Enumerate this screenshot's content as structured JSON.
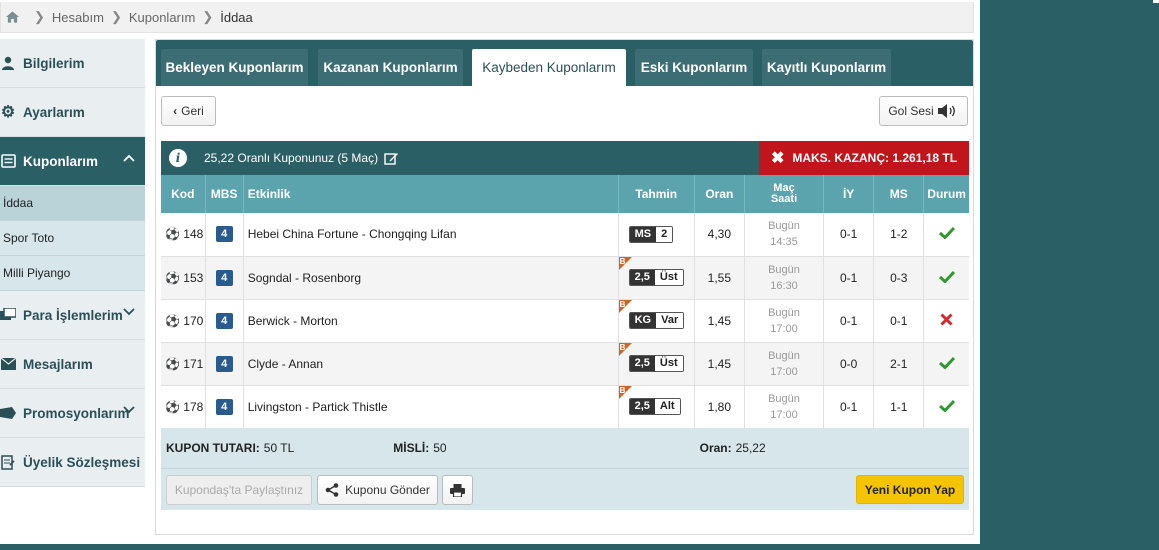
{
  "breadcrumb": {
    "items": [
      "Hesabım",
      "Kuponlarım"
    ],
    "current": "İddaa"
  },
  "sidebar": {
    "items": [
      {
        "label": "Bilgilerim",
        "icon": "user-icon"
      },
      {
        "label": "Ayarlarım",
        "icon": "gear-icon"
      },
      {
        "label": "Kuponlarım",
        "icon": "ticket-icon",
        "active": true
      },
      {
        "label": "Para İşlemlerim",
        "icon": "money-icon"
      },
      {
        "label": "Mesajlarım",
        "icon": "envelope-icon"
      },
      {
        "label": "Promosyonlarım",
        "icon": "tag-icon"
      },
      {
        "label": "Üyelik Sözleşmesi",
        "icon": "contract-icon"
      }
    ],
    "sub_items": [
      "İddaa",
      "Spor Toto",
      "Milli Piyango"
    ]
  },
  "tabs": [
    "Bekleyen Kuponlarım",
    "Kazanan Kuponlarım",
    "Kaybeden Kuponlarım",
    "Eski Kuponlarım",
    "Kayıtlı Kuponlarım"
  ],
  "active_tab": "Kaybeden Kuponlarım",
  "buttons": {
    "back": "Geri",
    "goal_sound": "Gol Sesi",
    "share": "Kupondaş'ta Paylaştınız",
    "send": "Kuponu Gönder",
    "new_coupon": "Yeni Kupon Yap"
  },
  "coupon": {
    "title": "25,22 Oranlı Kuponunuz (5 Maç)",
    "max_win": "MAKS. KAZANÇ: 1.261,18 TL",
    "columns": [
      "Kod",
      "MBS",
      "Etkinlik",
      "Tahmin",
      "Oran",
      "Maç Saati",
      "İY",
      "MS",
      "Durum"
    ],
    "rows": [
      {
        "kod": "148",
        "mbs": "4",
        "etkinlik": "Hebei China Fortune - Chongqing Lifan",
        "tahmin_k": "MS",
        "tahmin_v": "2",
        "badge": "",
        "oran": "4,30",
        "gun": "Bugün",
        "saat": "14:35",
        "iy": "0-1",
        "ms": "1-2",
        "durum": "won"
      },
      {
        "kod": "153",
        "mbs": "4",
        "etkinlik": "Sogndal - Rosenborg",
        "tahmin_k": "2,5",
        "tahmin_v": "Üst",
        "badge": "B",
        "oran": "1,55",
        "gun": "Bugün",
        "saat": "16:30",
        "iy": "0-1",
        "ms": "0-3",
        "durum": "won"
      },
      {
        "kod": "170",
        "mbs": "4",
        "etkinlik": "Berwick - Morton",
        "tahmin_k": "KG",
        "tahmin_v": "Var",
        "badge": "B",
        "oran": "1,45",
        "gun": "Bugün",
        "saat": "17:00",
        "iy": "0-1",
        "ms": "0-1",
        "durum": "lost"
      },
      {
        "kod": "171",
        "mbs": "4",
        "etkinlik": "Clyde - Annan",
        "tahmin_k": "2,5",
        "tahmin_v": "Üst",
        "badge": "B",
        "oran": "1,45",
        "gun": "Bugün",
        "saat": "17:00",
        "iy": "0-0",
        "ms": "2-1",
        "durum": "won"
      },
      {
        "kod": "178",
        "mbs": "4",
        "etkinlik": "Livingston - Partick Thistle",
        "tahmin_k": "2,5",
        "tahmin_v": "Alt",
        "badge": "B",
        "oran": "1,80",
        "gun": "Bugün",
        "saat": "17:00",
        "iy": "0-1",
        "ms": "1-1",
        "durum": "won"
      }
    ],
    "summary": {
      "tutar_label": "KUPON TUTARI:",
      "tutar": "50 TL",
      "misli_label": "MİSLİ:",
      "misli": "50",
      "oran_label": "Oran:",
      "oran": "25,22"
    }
  },
  "colors": {
    "primary": "#2b5f66",
    "header": "#5ba4ae",
    "danger": "#c0161b",
    "accent": "#f5c400",
    "won": "#2e9a2e",
    "lost": "#d2282e"
  }
}
